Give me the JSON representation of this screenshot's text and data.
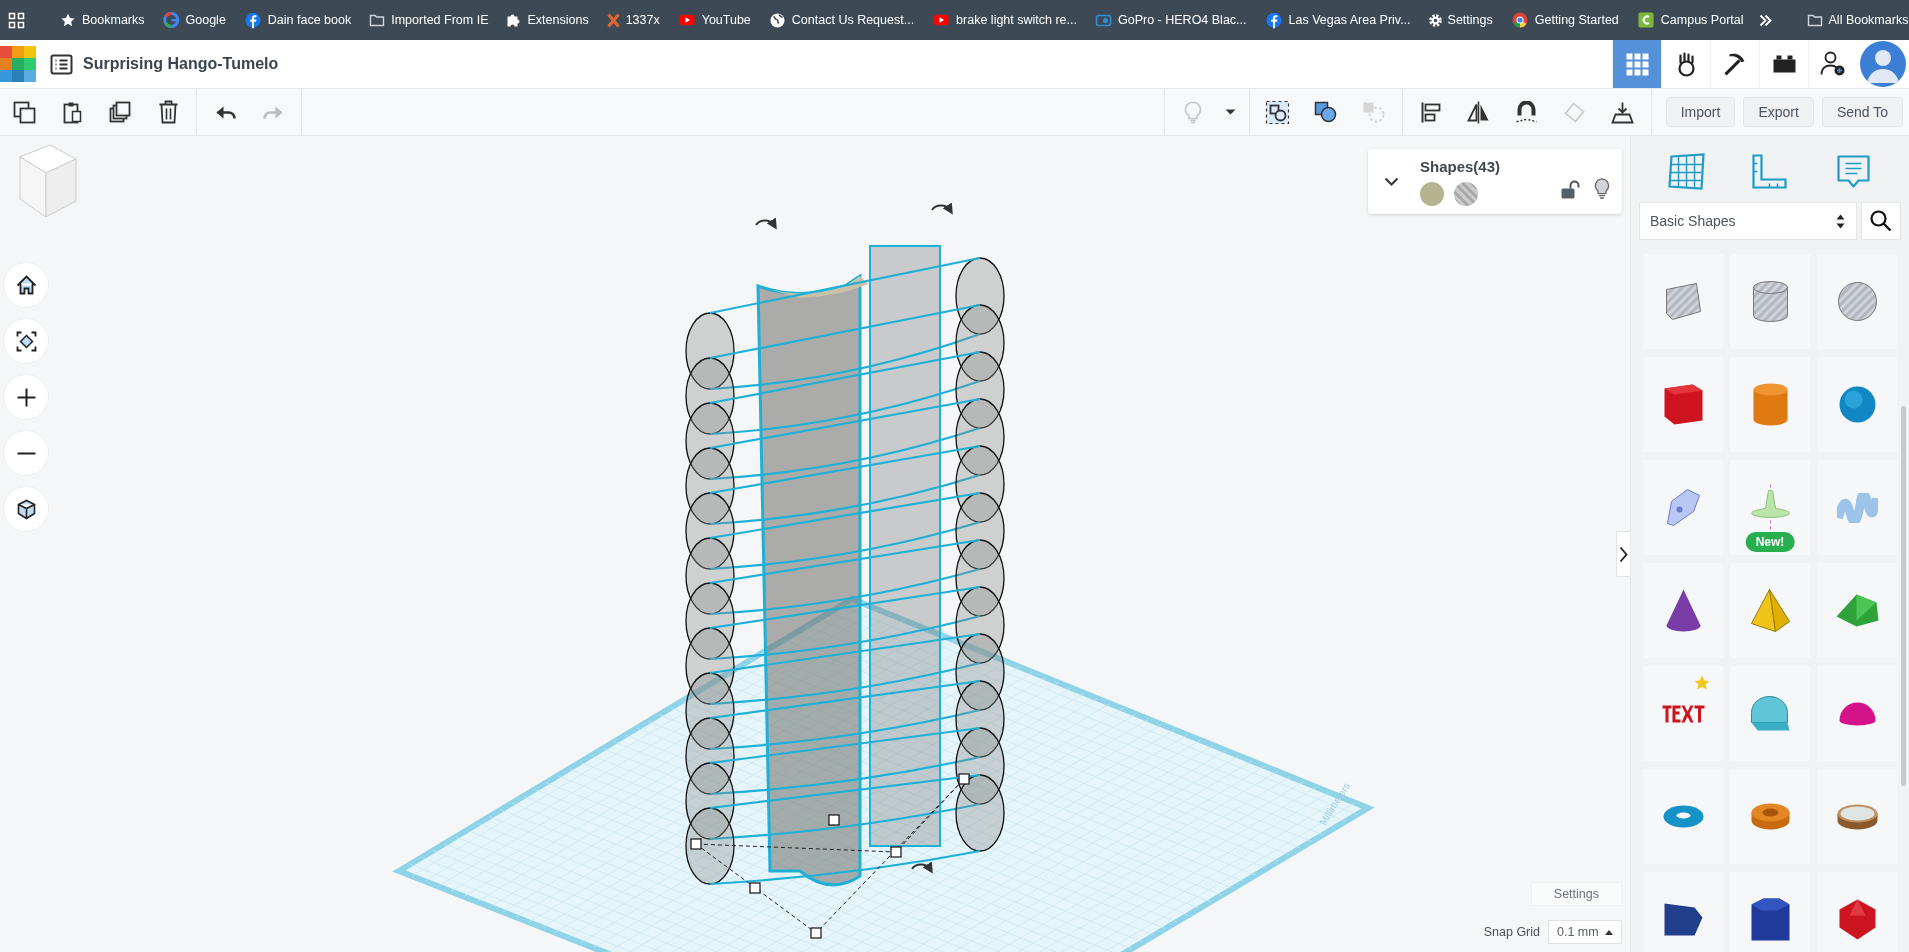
{
  "bookmarks_bar": {
    "items": [
      {
        "kind": "star",
        "label": "Bookmarks"
      },
      {
        "kind": "google",
        "label": "Google"
      },
      {
        "kind": "facebook",
        "label": "Dain face book"
      },
      {
        "kind": "folder",
        "label": "Imported From IE"
      },
      {
        "kind": "puzzle",
        "label": "Extensions"
      },
      {
        "kind": "torrent",
        "label": "1337x"
      },
      {
        "kind": "youtube",
        "label": "YouTube"
      },
      {
        "kind": "globe",
        "label": "Contact Us Request..."
      },
      {
        "kind": "youtube",
        "label": "brake light switch re..."
      },
      {
        "kind": "gopro",
        "label": "GoPro - HERO4 Blac..."
      },
      {
        "kind": "facebook",
        "label": "Las Vegas Area Priv..."
      },
      {
        "kind": "gear",
        "label": "Settings"
      },
      {
        "kind": "chrome",
        "label": "Getting Started"
      },
      {
        "kind": "campus",
        "label": "Campus Portal"
      }
    ],
    "all_bookmarks": "All Bookmarks"
  },
  "header": {
    "title": "Surprising Hango-Tumelo",
    "views": [
      {
        "kind": "grid",
        "selected": true
      },
      {
        "kind": "blocks",
        "selected": false
      },
      {
        "kind": "pickaxe",
        "selected": false
      },
      {
        "kind": "brick",
        "selected": false
      },
      {
        "kind": "add-user",
        "selected": false
      }
    ]
  },
  "toolbar": {
    "left": [
      {
        "kind": "copy",
        "disabled": false
      },
      {
        "kind": "paste",
        "disabled": false
      },
      {
        "kind": "duplicate",
        "disabled": false
      },
      {
        "kind": "delete",
        "disabled": false
      },
      {
        "kind": "undo",
        "disabled": false
      },
      {
        "kind": "redo",
        "disabled": true
      }
    ],
    "right": [
      {
        "kind": "bulb",
        "disabled": true
      },
      {
        "kind": "caret",
        "disabled": false
      },
      {
        "kind": "group",
        "disabled": false
      },
      {
        "kind": "solid",
        "disabled": false
      },
      {
        "kind": "hole",
        "disabled": true
      },
      {
        "kind": "align",
        "disabled": false
      },
      {
        "kind": "mirror",
        "disabled": false
      },
      {
        "kind": "magnet",
        "disabled": false
      },
      {
        "kind": "ruler",
        "disabled": true
      },
      {
        "kind": "drop",
        "disabled": false
      }
    ],
    "buttons": [
      "Import",
      "Export",
      "Send To"
    ]
  },
  "shapes_panel": {
    "title": "Shapes(43)",
    "expanded": true,
    "swatches": [
      {
        "kind": "solid",
        "color": "#b5b491"
      },
      {
        "kind": "hole"
      }
    ],
    "locked": false
  },
  "viewport": {
    "grid_unit": "Millimeters",
    "settings": "Settings",
    "snap_label": "Snap Grid",
    "snap_value": "0.1 mm"
  },
  "library": {
    "category": "Basic Shapes",
    "shapes": [
      {
        "kind": "box-hole",
        "starred": false
      },
      {
        "kind": "cylinder-hole",
        "starred": false
      },
      {
        "kind": "sphere-hole",
        "starred": false
      },
      {
        "kind": "box",
        "starred": false
      },
      {
        "kind": "cylinder",
        "starred": false
      },
      {
        "kind": "sphere",
        "starred": false
      },
      {
        "kind": "scribble",
        "starred": false
      },
      {
        "kind": "spinner",
        "badge": "New!",
        "starred": false
      },
      {
        "kind": "wave",
        "starred": false
      },
      {
        "kind": "cone",
        "starred": false
      },
      {
        "kind": "pyramid",
        "starred": false
      },
      {
        "kind": "roof",
        "starred": false
      },
      {
        "kind": "text",
        "starred": true
      },
      {
        "kind": "half-cylinder",
        "starred": false
      },
      {
        "kind": "half-sphere",
        "starred": false
      },
      {
        "kind": "torus",
        "starred": false
      },
      {
        "kind": "tube",
        "starred": false
      },
      {
        "kind": "ring",
        "starred": false
      },
      {
        "kind": "wedge",
        "starred": false
      },
      {
        "kind": "prism",
        "starred": false
      },
      {
        "kind": "polyhedron",
        "starred": false
      }
    ]
  }
}
